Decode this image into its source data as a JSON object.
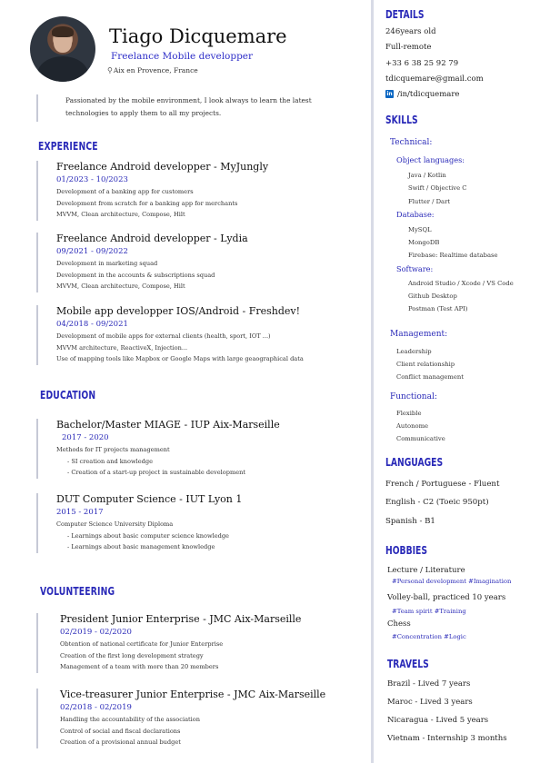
{
  "header": {
    "name": "Tiago Dicquemare",
    "role": "Freelance Mobile developper",
    "location": "Aix en Provence, France",
    "intro_line1": "Passionated by the mobile environment, I look always to learn the latest",
    "intro_line2": "technologies to apply them to all my projects."
  },
  "experience": {
    "title": "EXPERIENCE",
    "items": [
      {
        "title": "Freelance Android developper - MyJungly",
        "dates": "01/2023 - 10/2023",
        "lines": [
          "Development of a banking app for customers",
          "Development from scratch for a banking app for merchants",
          "MVVM, Clean architecture, Compose, Hilt"
        ]
      },
      {
        "title": "Freelance Android developper - Lydia",
        "dates": "09/2021 - 09/2022",
        "lines": [
          "Development in marketing squad",
          "Development in the accounts & subscriptions squad",
          "MVVM, Clean architecture, Compose, Hilt"
        ]
      },
      {
        "title": "Mobile app developper IOS/Android - Freshdev!",
        "dates": "04/2018 - 09/2021",
        "lines": [
          "Development of mobile apps for external clients (health, sport, IOT ...)",
          "MVVM architecture,  ReactiveX, Injection...",
          "Use of mapping tools like Mapbox or Google Maps with large  geaographical data"
        ]
      }
    ]
  },
  "education": {
    "title": "EDUCATION",
    "items": [
      {
        "title": "Bachelor/Master MIAGE  - IUP Aix-Marseille",
        "dates": "2017 - 2020",
        "lines": [
          "Methods for IT projects management",
          "- SI creation and knowledge",
          "- Creation of a start-up project in sustainable development"
        ]
      },
      {
        "title": "DUT Computer Science - IUT Lyon 1",
        "dates": "2015 - 2017",
        "lines": [
          "Computer Science University Diploma",
          "- Learnings about basic computer science knowledge",
          "- Learnings about basic management knowledge"
        ]
      }
    ]
  },
  "volunteering": {
    "title": "VOLUNTEERING",
    "items": [
      {
        "title": "President Junior Enterprise - JMC Aix-Marseille",
        "dates": "02/2019 - 02/2020",
        "lines": [
          "Obtention of national certificate for Junior Enterprise",
          "Creation of the first long development strategy",
          "Management of a team with more than 20 members"
        ]
      },
      {
        "title": "Vice-treasurer Junior Enterprise - JMC Aix-Marseille",
        "dates": "02/2018 - 02/2019",
        "lines": [
          "Handling the accountability of the association",
          "Control of social and fiscal declarations",
          "Creation of a provisional annual budget"
        ]
      }
    ]
  },
  "details": {
    "title": "DETAILS",
    "age": "246years old",
    "work": "Full-remote",
    "phone": "+33 6 38 25 92 79",
    "email": "tdicquemare@gmail.com",
    "linkedin": "/in/tdicquemare"
  },
  "skills": {
    "title": "SKILLS",
    "technical": "Technical:",
    "object_languages": "Object languages:",
    "object_items": [
      "Java / Kotlin",
      "Swift / Objective C",
      "Flutter / Dart"
    ],
    "database": "Database:",
    "database_items": [
      "MySQL",
      "MongoDB",
      "Firebase: Realtime database"
    ],
    "software": "Software:",
    "software_items": [
      "Android Studio / Xcode / VS Code",
      "Github Desktop",
      "Postman (Test API)"
    ],
    "management": "Management:",
    "management_items": [
      "Leadership",
      "Client relationship",
      "Conflict management"
    ],
    "functional": "Functional:",
    "functional_items": [
      "Flexible",
      "Autonome",
      "Communicative"
    ]
  },
  "languages": {
    "title": "LANGUAGES",
    "items": [
      "French / Portuguese - Fluent",
      "English - C2 (Toeic 950pt)",
      "Spanish - B1"
    ]
  },
  "hobbies": {
    "title": "HOBBIES",
    "items": [
      {
        "label": "Lecture / Literature",
        "tags": "#Personal development  #Imagination"
      },
      {
        "label": "Volley-ball, practiced 10 years",
        "tags": "#Team spirit  #Training"
      },
      {
        "label": "Chess",
        "tags": "#Concentration  #Logic"
      }
    ]
  },
  "travels": {
    "title": "TRAVELS",
    "items": [
      "Brazil - Lived 7 years",
      "Maroc - Lived 3 years",
      "Nicaragua - Lived 5 years",
      "Vietnam - Internship 3 months"
    ]
  },
  "icons": {
    "pin": "location-pin-icon",
    "linkedin": "linkedin-icon"
  },
  "colors": {
    "accent": "#2a2ab8",
    "divider": "#d8dbe6"
  }
}
